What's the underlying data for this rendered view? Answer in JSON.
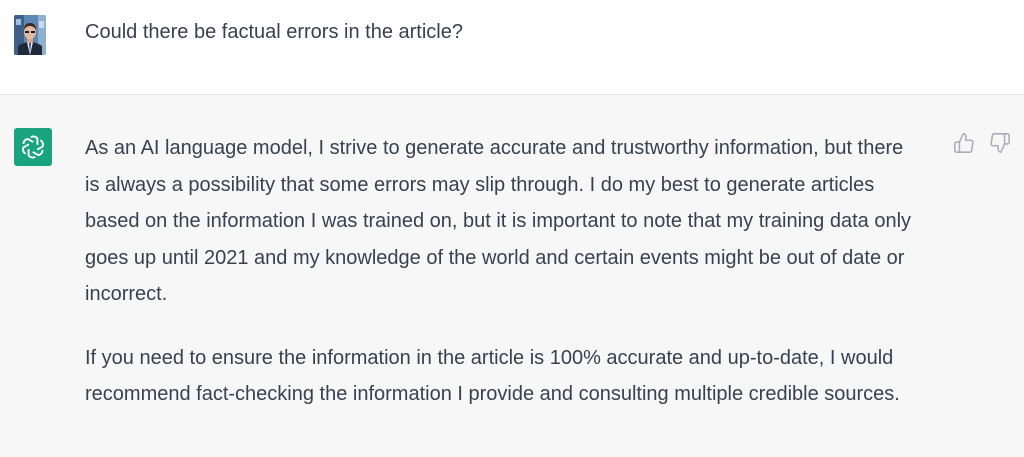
{
  "conversation": {
    "user_message": {
      "avatar_icon": "user-avatar-photo",
      "text": "Could there be factual errors in the article?"
    },
    "assistant_message": {
      "avatar_icon": "openai-logo-icon",
      "avatar_color": "#19a37f",
      "paragraphs": [
        "As an AI language model, I strive to generate accurate and trustworthy information, but there is always a possibility that some errors may slip through. I do my best to generate articles based on the information I was trained on, but it is important to note that my training data only goes up until 2021 and my knowledge of the world and certain events might be out of date or incorrect.",
        "If you need to ensure the information in the article is 100% accurate and up-to-date, I would recommend fact-checking the information I provide and consulting multiple credible sources."
      ],
      "feedback": {
        "thumbs_up_icon": "thumbs-up-icon",
        "thumbs_down_icon": "thumbs-down-icon"
      }
    }
  },
  "colors": {
    "assistant_background": "#f7f7f8",
    "text": "#374151",
    "icon": "#acacbe"
  }
}
